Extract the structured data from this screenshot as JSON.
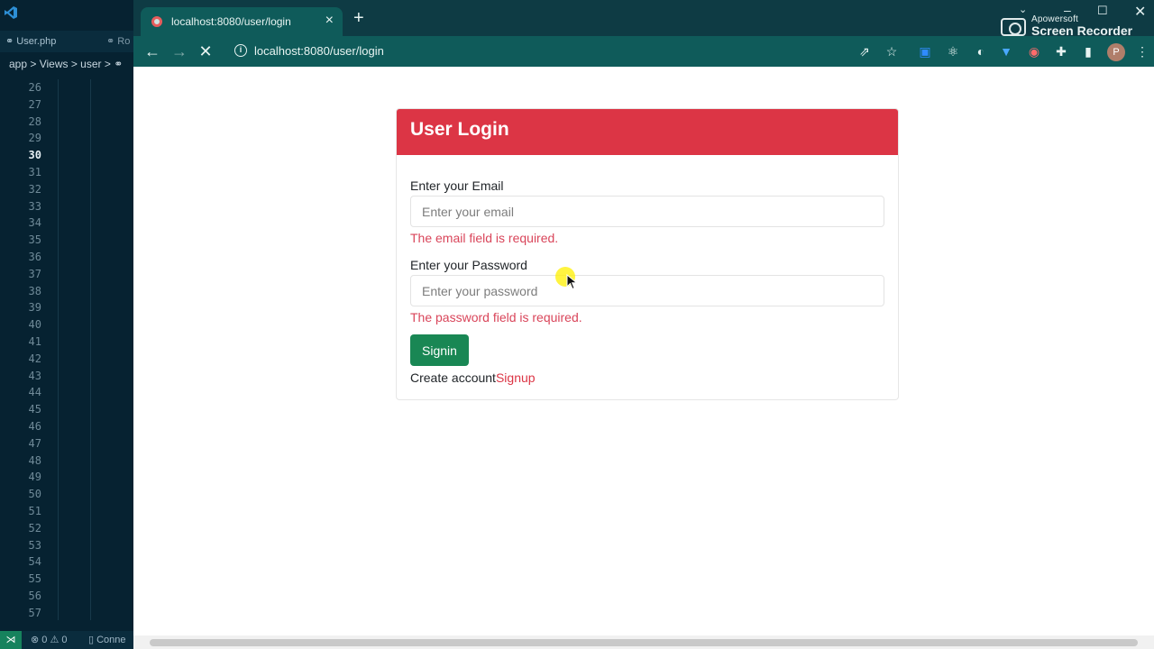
{
  "editor": {
    "tab_1": "User.php",
    "tab_2": "Ro",
    "breadcrumb": "app > Views > user > ",
    "line_numbers": [
      "26",
      "27",
      "28",
      "29",
      "30",
      "31",
      "32",
      "33",
      "34",
      "35",
      "36",
      "37",
      "38",
      "39",
      "40",
      "41",
      "42",
      "43",
      "44",
      "45",
      "46",
      "47",
      "48",
      "49",
      "50",
      "51",
      "52",
      "53",
      "54",
      "55",
      "56",
      "57"
    ],
    "current_line": "30",
    "status_errors": "⊗ 0 ⚠ 0",
    "status_conn": "Conne"
  },
  "browser": {
    "tab_title": "localhost:8080/user/login",
    "address": "localhost:8080/user/login",
    "profile_initial": "P"
  },
  "recorder": {
    "brand_small": "Apowersoft",
    "brand_big": "Screen Recorder"
  },
  "login": {
    "title": "User Login",
    "email_label": "Enter your Email",
    "email_placeholder": "Enter your email",
    "email_error": "The email field is required.",
    "password_label": "Enter your Password",
    "password_placeholder": "Enter your password",
    "password_error": "The password field is required.",
    "signin_label": "Signin",
    "create_text": "Create account",
    "signup_link": "Signup"
  },
  "colors": {
    "header_red": "#dc3545",
    "button_green": "#198754",
    "error_text": "#d9455a",
    "browser_chrome": "#0f5b5a"
  }
}
